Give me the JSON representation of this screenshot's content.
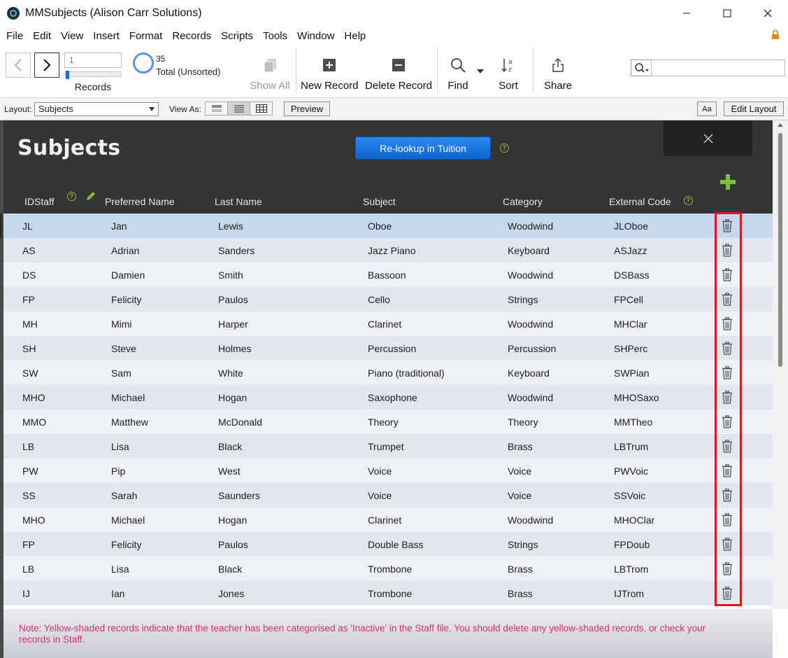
{
  "window": {
    "title": "MMSubjects (Alison Carr Solutions)"
  },
  "menu": [
    "File",
    "Edit",
    "View",
    "Insert",
    "Format",
    "Records",
    "Scripts",
    "Tools",
    "Window",
    "Help"
  ],
  "toolbar": {
    "record_number": "1",
    "records_label": "Records",
    "total_count": "35",
    "total_label": "Total (Unsorted)",
    "show_all": "Show All",
    "new_record": "New Record",
    "delete_record": "Delete Record",
    "find": "Find",
    "sort": "Sort",
    "share": "Share",
    "quick_find_value": ""
  },
  "layoutbar": {
    "layout_label": "Layout:",
    "layout_value": "Subjects",
    "view_as_label": "View As:",
    "preview": "Preview",
    "text_format": "Aa",
    "edit_layout": "Edit Layout"
  },
  "page": {
    "title": "Subjects",
    "relookup_button": "Re-lookup in Tuition",
    "help_glyph": "?"
  },
  "columns": {
    "idstaff": "IDStaff",
    "preferred_name": "Preferred Name",
    "last_name": "Last Name",
    "subject": "Subject",
    "category": "Category",
    "external_code": "External Code"
  },
  "rows": [
    {
      "id": "JL",
      "preferred": "Jan",
      "last": "Lewis",
      "subject": "Oboe",
      "category": "Woodwind",
      "code": "JLOboe"
    },
    {
      "id": "AS",
      "preferred": "Adrian",
      "last": "Sanders",
      "subject": "Jazz Piano",
      "category": "Keyboard",
      "code": "ASJazz"
    },
    {
      "id": "DS",
      "preferred": "Damien",
      "last": "Smith",
      "subject": "Bassoon",
      "category": "Woodwind",
      "code": "DSBass"
    },
    {
      "id": "FP",
      "preferred": "Felicity",
      "last": "Paulos",
      "subject": "Cello",
      "category": "Strings",
      "code": "FPCell"
    },
    {
      "id": "MH",
      "preferred": "Mimi",
      "last": "Harper",
      "subject": "Clarinet",
      "category": "Woodwind",
      "code": "MHClar"
    },
    {
      "id": "SH",
      "preferred": "Steve",
      "last": "Holmes",
      "subject": "Percussion",
      "category": "Percussion",
      "code": "SHPerc"
    },
    {
      "id": "SW",
      "preferred": "Sam",
      "last": "White",
      "subject": "Piano (traditional)",
      "category": "Keyboard",
      "code": "SWPian"
    },
    {
      "id": "MHO",
      "preferred": "Michael",
      "last": "Hogan",
      "subject": "Saxophone",
      "category": "Woodwind",
      "code": "MHOSaxo"
    },
    {
      "id": "MMO",
      "preferred": "Matthew",
      "last": "McDonald",
      "subject": "Theory",
      "category": "Theory",
      "code": "MMTheo"
    },
    {
      "id": "LB",
      "preferred": "Lisa",
      "last": "Black",
      "subject": "Trumpet",
      "category": "Brass",
      "code": "LBTrum"
    },
    {
      "id": "PW",
      "preferred": "Pip",
      "last": "West",
      "subject": "Voice",
      "category": "Voice",
      "code": "PWVoic"
    },
    {
      "id": "SS",
      "preferred": "Sarah",
      "last": "Saunders",
      "subject": "Voice",
      "category": "Voice",
      "code": "SSVoic"
    },
    {
      "id": "MHO",
      "preferred": "Michael",
      "last": "Hogan",
      "subject": "Clarinet",
      "category": "Woodwind",
      "code": "MHOClar"
    },
    {
      "id": "FP",
      "preferred": "Felicity",
      "last": "Paulos",
      "subject": "Double Bass",
      "category": "Strings",
      "code": "FPDoub"
    },
    {
      "id": "LB",
      "preferred": "Lisa",
      "last": "Black",
      "subject": "Trombone",
      "category": "Brass",
      "code": "LBTrom"
    },
    {
      "id": "IJ",
      "preferred": "Ian",
      "last": "Jones",
      "subject": "Trombone",
      "category": "Brass",
      "code": "IJTrom"
    }
  ],
  "footer": {
    "note": "Note: Yellow-shaded records indicate that the teacher has been categorised as 'Inactive' in the Staff file.  You should delete any yellow-shaded records, or check your records in Staff."
  },
  "colors": {
    "accent_blue": "#0e63cc",
    "add_green": "#7cc13a",
    "highlight_red": "#e0151c",
    "note_pink": "#d6306a"
  }
}
